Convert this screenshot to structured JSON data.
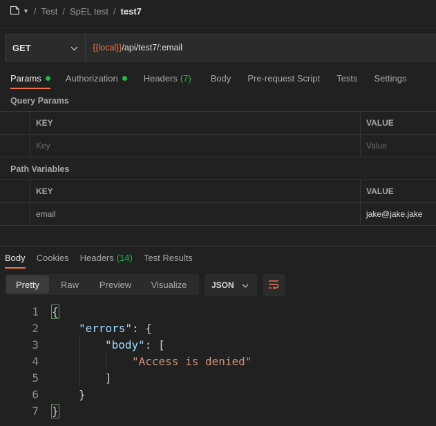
{
  "breadcrumb": {
    "items": [
      "Test",
      "SpEL test"
    ],
    "current": "test7",
    "separator": "/"
  },
  "request": {
    "method": "GET",
    "url_var": "{{local}}",
    "url_path": "/api/test7/:email"
  },
  "tabs": [
    {
      "label": "Params",
      "indicator": "dot"
    },
    {
      "label": "Authorization",
      "indicator": "dot"
    },
    {
      "label": "Headers",
      "count": "(7)"
    },
    {
      "label": "Body"
    },
    {
      "label": "Pre-request Script"
    },
    {
      "label": "Tests"
    },
    {
      "label": "Settings"
    }
  ],
  "query_params": {
    "title": "Query Params",
    "col_key": "KEY",
    "col_value": "VALUE",
    "key_placeholder": "Key",
    "value_placeholder": "Value"
  },
  "path_variables": {
    "title": "Path Variables",
    "col_key": "KEY",
    "col_value": "VALUE",
    "rows": [
      {
        "key": "email",
        "value": "jake@jake.jake"
      }
    ]
  },
  "response_tabs": [
    {
      "label": "Body"
    },
    {
      "label": "Cookies"
    },
    {
      "label": "Headers",
      "count": "(14)"
    },
    {
      "label": "Test Results"
    }
  ],
  "views": [
    "Pretty",
    "Raw",
    "Preview",
    "Visualize"
  ],
  "format": "JSON",
  "code": {
    "line_numbers": [
      "1",
      "2",
      "3",
      "4",
      "5",
      "6",
      "7"
    ],
    "open_brace": "{",
    "errors_key": "\"errors\"",
    "colon_open": ": {",
    "body_key": "\"body\"",
    "colon_bracket": ": [",
    "message": "\"Access is denied\"",
    "close_bracket": "]",
    "close_inner": "}",
    "close_brace": "}"
  },
  "colors": {
    "accent": "#f2754b",
    "success": "#1fba4a",
    "json_key": "#9cdcfe",
    "json_string": "#ce9178"
  }
}
